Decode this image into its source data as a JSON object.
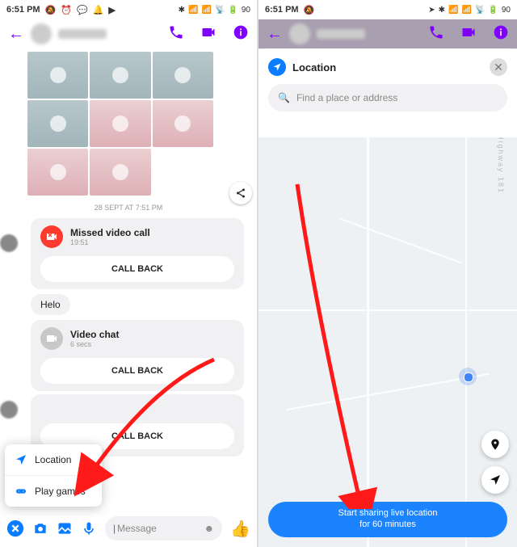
{
  "status": {
    "time": "6:51 PM",
    "battery": "90"
  },
  "chat": {
    "timestamp": "28 SEPT AT 7:51 PM",
    "missed": {
      "title": "Missed video call",
      "sub": "19:51",
      "cb": "CALL BACK"
    },
    "helo": "Helo",
    "vchat": {
      "title": "Video chat",
      "sub": "6 secs",
      "cb": "CALL BACK"
    },
    "trailing_cb": "CALL BACK",
    "composer_placeholder": "Message"
  },
  "popup": {
    "location": "Location",
    "games": "Play games"
  },
  "loc": {
    "title": "Location",
    "search_placeholder": "Find a place or address",
    "road_label": "Highway 181",
    "share_line1": "Start sharing live location",
    "share_line2": "for 60 minutes"
  }
}
